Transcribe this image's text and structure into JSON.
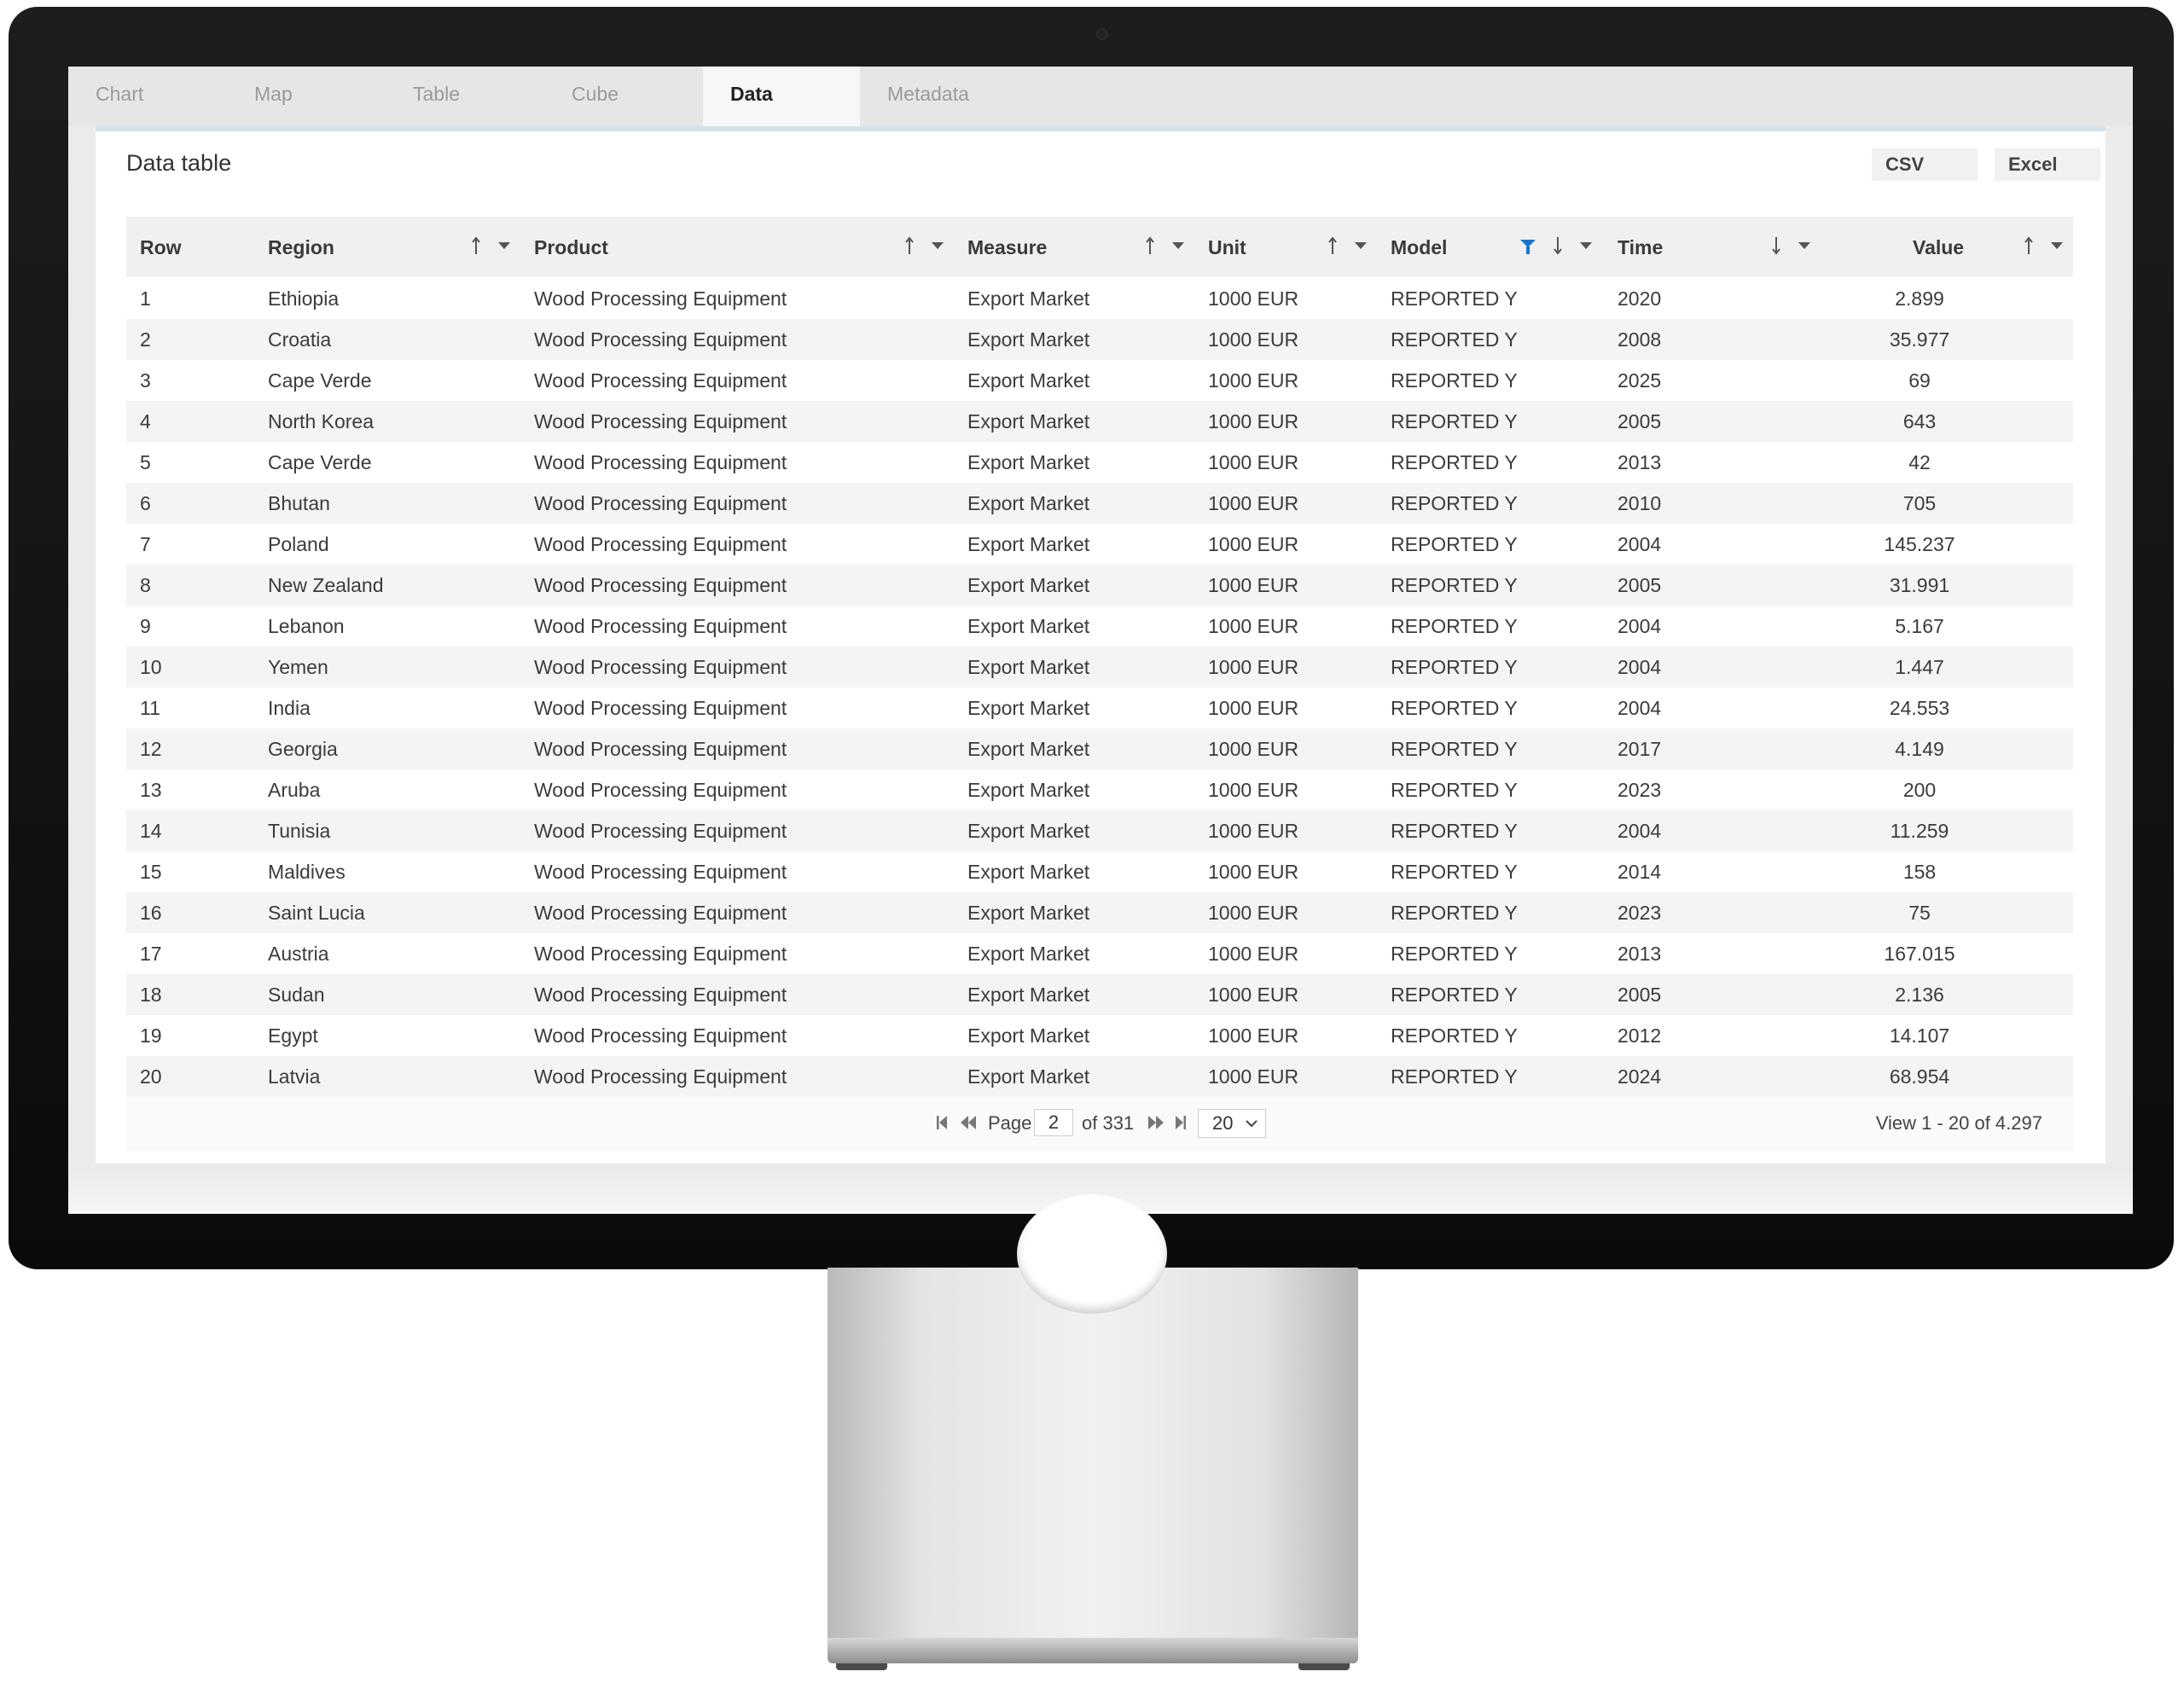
{
  "tabs": [
    {
      "label": "Chart",
      "active": false
    },
    {
      "label": "Map",
      "active": false
    },
    {
      "label": "Table",
      "active": false
    },
    {
      "label": "Cube",
      "active": false
    },
    {
      "label": "Data",
      "active": true
    },
    {
      "label": "Metadata",
      "active": false
    }
  ],
  "panel": {
    "title": "Data table",
    "export": {
      "csv": "CSV",
      "excel": "Excel"
    }
  },
  "table": {
    "headers": {
      "row": "Row",
      "region": "Region",
      "product": "Product",
      "measure": "Measure",
      "unit": "Unit",
      "model": "Model",
      "time": "Time",
      "value": "Value"
    },
    "rows": [
      {
        "row": "1",
        "region": "Ethiopia",
        "product": "Wood Processing Equipment",
        "measure": "Export Market",
        "unit": "1000 EUR",
        "model": "REPORTED Y",
        "time": "2020",
        "value": "2.899"
      },
      {
        "row": "2",
        "region": "Croatia",
        "product": "Wood Processing Equipment",
        "measure": "Export Market",
        "unit": "1000 EUR",
        "model": "REPORTED Y",
        "time": "2008",
        "value": "35.977"
      },
      {
        "row": "3",
        "region": "Cape Verde",
        "product": "Wood Processing Equipment",
        "measure": "Export Market",
        "unit": "1000 EUR",
        "model": "REPORTED Y",
        "time": "2025",
        "value": "69"
      },
      {
        "row": "4",
        "region": "North Korea",
        "product": "Wood Processing Equipment",
        "measure": "Export Market",
        "unit": "1000 EUR",
        "model": "REPORTED Y",
        "time": "2005",
        "value": "643"
      },
      {
        "row": "5",
        "region": "Cape Verde",
        "product": "Wood Processing Equipment",
        "measure": "Export Market",
        "unit": "1000 EUR",
        "model": "REPORTED Y",
        "time": "2013",
        "value": "42"
      },
      {
        "row": "6",
        "region": "Bhutan",
        "product": "Wood Processing Equipment",
        "measure": "Export Market",
        "unit": "1000 EUR",
        "model": "REPORTED Y",
        "time": "2010",
        "value": "705"
      },
      {
        "row": "7",
        "region": "Poland",
        "product": "Wood Processing Equipment",
        "measure": "Export Market",
        "unit": "1000 EUR",
        "model": "REPORTED Y",
        "time": "2004",
        "value": "145.237"
      },
      {
        "row": "8",
        "region": "New Zealand",
        "product": "Wood Processing Equipment",
        "measure": "Export Market",
        "unit": "1000 EUR",
        "model": "REPORTED Y",
        "time": "2005",
        "value": "31.991"
      },
      {
        "row": "9",
        "region": "Lebanon",
        "product": "Wood Processing Equipment",
        "measure": "Export Market",
        "unit": "1000 EUR",
        "model": "REPORTED Y",
        "time": "2004",
        "value": "5.167"
      },
      {
        "row": "10",
        "region": "Yemen",
        "product": "Wood Processing Equipment",
        "measure": "Export Market",
        "unit": "1000 EUR",
        "model": "REPORTED Y",
        "time": "2004",
        "value": "1.447"
      },
      {
        "row": "11",
        "region": "India",
        "product": "Wood Processing Equipment",
        "measure": "Export Market",
        "unit": "1000 EUR",
        "model": "REPORTED Y",
        "time": "2004",
        "value": "24.553"
      },
      {
        "row": "12",
        "region": "Georgia",
        "product": "Wood Processing Equipment",
        "measure": "Export Market",
        "unit": "1000 EUR",
        "model": "REPORTED Y",
        "time": "2017",
        "value": "4.149"
      },
      {
        "row": "13",
        "region": "Aruba",
        "product": "Wood Processing Equipment",
        "measure": "Export Market",
        "unit": "1000 EUR",
        "model": "REPORTED Y",
        "time": "2023",
        "value": "200"
      },
      {
        "row": "14",
        "region": "Tunisia",
        "product": "Wood Processing Equipment",
        "measure": "Export Market",
        "unit": "1000 EUR",
        "model": "REPORTED Y",
        "time": "2004",
        "value": "11.259"
      },
      {
        "row": "15",
        "region": "Maldives",
        "product": "Wood Processing Equipment",
        "measure": "Export Market",
        "unit": "1000 EUR",
        "model": "REPORTED Y",
        "time": "2014",
        "value": "158"
      },
      {
        "row": "16",
        "region": "Saint Lucia",
        "product": "Wood Processing Equipment",
        "measure": "Export Market",
        "unit": "1000 EUR",
        "model": "REPORTED Y",
        "time": "2023",
        "value": "75"
      },
      {
        "row": "17",
        "region": "Austria",
        "product": "Wood Processing Equipment",
        "measure": "Export Market",
        "unit": "1000 EUR",
        "model": "REPORTED Y",
        "time": "2013",
        "value": "167.015"
      },
      {
        "row": "18",
        "region": "Sudan",
        "product": "Wood Processing Equipment",
        "measure": "Export Market",
        "unit": "1000 EUR",
        "model": "REPORTED Y",
        "time": "2005",
        "value": "2.136"
      },
      {
        "row": "19",
        "region": "Egypt",
        "product": "Wood Processing Equipment",
        "measure": "Export Market",
        "unit": "1000 EUR",
        "model": "REPORTED Y",
        "time": "2012",
        "value": "14.107"
      },
      {
        "row": "20",
        "region": "Latvia",
        "product": "Wood Processing Equipment",
        "measure": "Export Market",
        "unit": "1000 EUR",
        "model": "REPORTED Y",
        "time": "2024",
        "value": "68.954"
      }
    ]
  },
  "pager": {
    "page_label": "Page",
    "page_value": "2",
    "of_label": "of 331",
    "page_size": "20",
    "view_info": "View 1 - 20 of 4.297"
  },
  "colors": {
    "filter_active": "#1a73c9",
    "tab_accent": "#d5e1e8"
  }
}
